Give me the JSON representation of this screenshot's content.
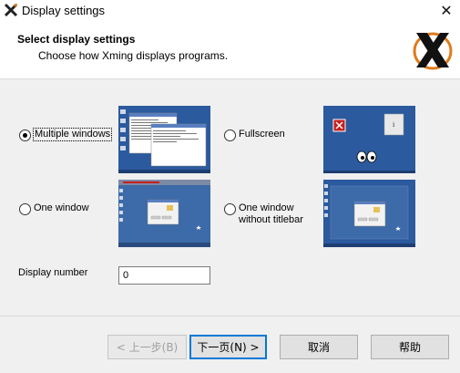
{
  "window": {
    "title": "Display settings",
    "close_glyph": "✕"
  },
  "header": {
    "title": "Select display settings",
    "subtitle": "Choose how Xming displays programs."
  },
  "options": {
    "multiple_windows": {
      "label": "Multiple windows",
      "selected": true
    },
    "fullscreen": {
      "label": "Fullscreen",
      "selected": false
    },
    "one_window": {
      "label": "One window",
      "selected": false
    },
    "one_window_no_titlebar": {
      "label_line1": "One window",
      "label_line2": "without titlebar",
      "selected": false
    }
  },
  "display_number": {
    "label": "Display number",
    "value": "0"
  },
  "buttons": {
    "back": "< 上一步(B)",
    "next": "下一页(N) >",
    "cancel": "取消",
    "help": "帮助"
  },
  "colors": {
    "desktop_blue": "#2b5a9e",
    "accent": "#0078d7"
  },
  "icons": [
    "xming-app-icon",
    "close-icon",
    "xming-logo",
    "radio-button"
  ]
}
